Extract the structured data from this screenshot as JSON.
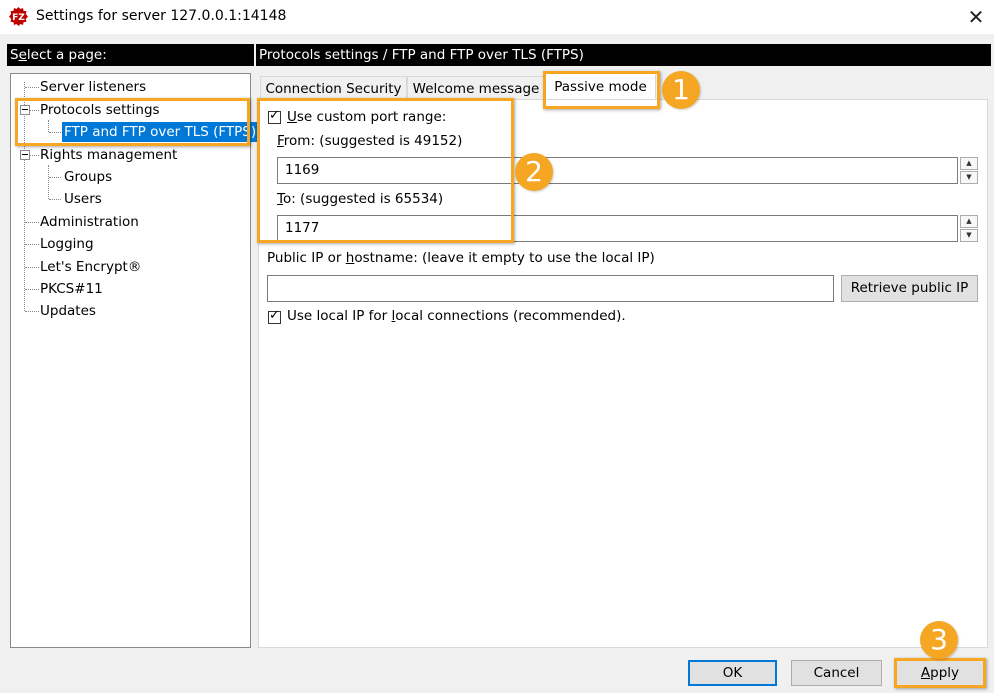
{
  "window": {
    "title": "Settings for server 127.0.0.1:14148",
    "close_glyph": "✕",
    "app_icon": "filezilla-icon"
  },
  "left_panel": {
    "header": "Select a page:",
    "tree": [
      {
        "label": "Server listeners"
      },
      {
        "label": "Protocols settings"
      },
      {
        "label": "FTP and FTP over TLS (FTPS)",
        "selected": true
      },
      {
        "label": "Rights management"
      },
      {
        "label": "Groups"
      },
      {
        "label": "Users"
      },
      {
        "label": "Administration"
      },
      {
        "label": "Logging"
      },
      {
        "label": "Let's Encrypt®"
      },
      {
        "label": "PKCS#11"
      },
      {
        "label": "Updates"
      }
    ]
  },
  "right_panel": {
    "header": "Protocols settings / FTP and FTP over TLS (FTPS)",
    "tabs": [
      {
        "label": "Connection Security"
      },
      {
        "label": "Welcome message"
      },
      {
        "label": "Passive mode",
        "active": true
      }
    ],
    "passive": {
      "custom_range_label_pre": "",
      "custom_range_label_u": "U",
      "custom_range_label_post": "se custom port range:",
      "custom_range_checked": true,
      "from_label_u": "F",
      "from_label_post": "rom: (suggested is 49152)",
      "from_value": "1169",
      "to_label_u": "T",
      "to_label_post": "o: (suggested is 65534)",
      "to_value": "1177",
      "public_ip_label_pre": "Public IP or ",
      "public_ip_label_u": "h",
      "public_ip_label_post": "ostname: (leave it empty to use the local IP)",
      "public_ip_value": "",
      "retrieve_button": "Retrieve public IP",
      "local_ip_label_pre": "Use local IP for ",
      "local_ip_label_u": "l",
      "local_ip_label_post": "ocal connections (recommended).",
      "local_ip_checked": true
    }
  },
  "buttons": {
    "ok": "OK",
    "cancel": "Cancel",
    "apply_u": "A",
    "apply_post": "pply"
  },
  "annotations": {
    "color": "#f5a623",
    "badges": [
      "1",
      "2",
      "3"
    ]
  }
}
